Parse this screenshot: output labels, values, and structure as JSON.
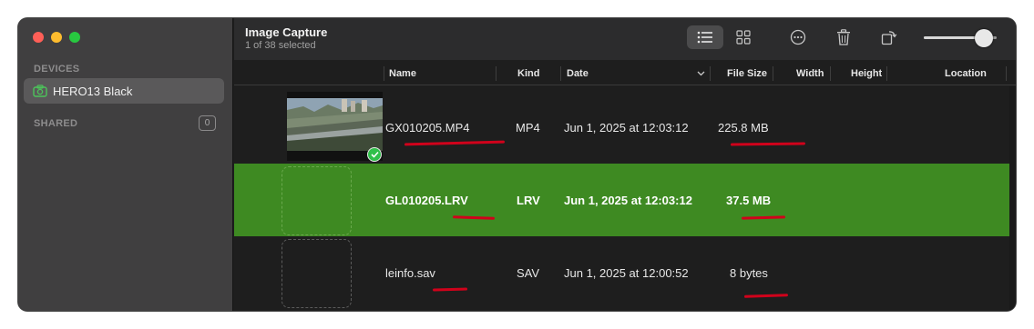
{
  "window": {
    "app_title": "Image Capture",
    "subtitle": "1 of 38 selected"
  },
  "sidebar": {
    "devices_label": "DEVICES",
    "device_name": "HERO13 Black",
    "shared_label": "SHARED",
    "shared_count": "0"
  },
  "toolbar": {
    "icons": [
      "list-view-icon",
      "grid-view-icon",
      "more-icon",
      "trash-icon",
      "rotate-icon"
    ],
    "thumbnail_size_level": 0.82
  },
  "table": {
    "columns": {
      "name": "Name",
      "kind": "Kind",
      "date": "Date",
      "file_size": "File Size",
      "width": "Width",
      "height": "Height",
      "location": "Location"
    },
    "rows": [
      {
        "name": "GX010205.MP4",
        "kind": "MP4",
        "date": "Jun 1, 2025 at 12:03:12",
        "file_size": "225.8 MB",
        "selected": false,
        "imported": true
      },
      {
        "name": "GL010205.LRV",
        "kind": "LRV",
        "date": "Jun 1, 2025 at 12:03:12",
        "file_size": "37.5 MB",
        "selected": true,
        "imported": false
      },
      {
        "name": "leinfo.sav",
        "kind": "SAV",
        "date": "Jun 1, 2025 at 12:00:52",
        "file_size": "8 bytes",
        "selected": false,
        "imported": false
      }
    ]
  },
  "colors": {
    "selection": "#3e8a22",
    "annotation": "#d0021b",
    "sidebar_bg": "#403f40"
  }
}
